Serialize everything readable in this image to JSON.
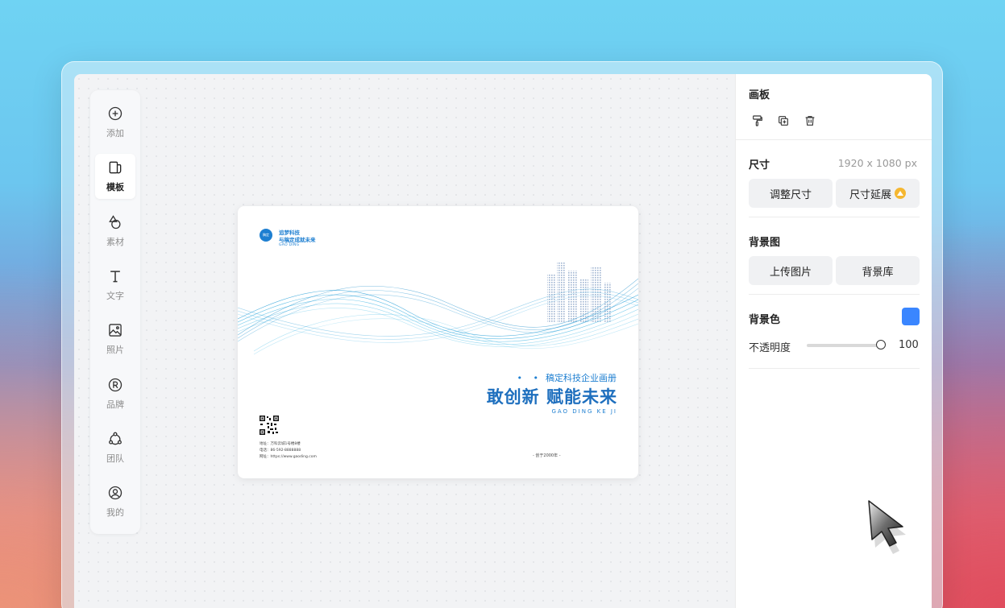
{
  "toolbar": {
    "items": [
      {
        "label": "添加",
        "icon": "add-circle-icon"
      },
      {
        "label": "模板",
        "icon": "template-icon",
        "active": true
      },
      {
        "label": "素材",
        "icon": "shapes-icon"
      },
      {
        "label": "文字",
        "icon": "text-icon"
      },
      {
        "label": "照片",
        "icon": "image-icon"
      },
      {
        "label": "品牌",
        "icon": "registered-icon"
      },
      {
        "label": "团队",
        "icon": "team-icon"
      },
      {
        "label": "我的",
        "icon": "user-icon"
      }
    ]
  },
  "card": {
    "logo_text": "稿定",
    "brand_line1": "追梦科技",
    "brand_line2": "与稿定成就未来",
    "brand_small": "GAO DING",
    "subtitle_dots": "• •",
    "subtitle": "稿定科技企业画册",
    "headline": "敢创新 赋能未来",
    "pinyin": "GAO DING KE JI",
    "info1": "地址：万科云城1号楼8楼",
    "info2": "电话：86-592-8888888",
    "info3": "网址：https://www.gaoding.com",
    "founded": "- 创于2000年 -",
    "accent": "#1e7fd1"
  },
  "panel": {
    "board_title": "画板",
    "board_icons": [
      "paint-roller-icon",
      "duplicate-icon",
      "trash-icon"
    ],
    "size_title": "尺寸",
    "size_value": "1920 x 1080 px",
    "resize_label": "调整尺寸",
    "extend_label": "尺寸延展",
    "bg_image_title": "背景图",
    "upload_label": "上传图片",
    "library_label": "背景库",
    "bg_color_title": "背景色",
    "bg_color": "#3a86ff",
    "opacity_label": "不透明度",
    "opacity_value": "100"
  }
}
